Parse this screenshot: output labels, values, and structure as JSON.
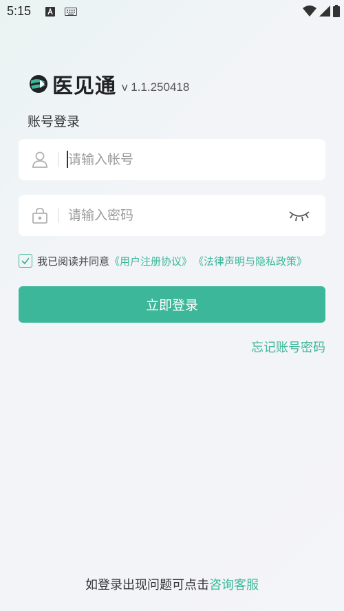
{
  "status_bar": {
    "time": "5:15",
    "icons": [
      "a-notification-icon",
      "keyboard-icon",
      "wifi-icon",
      "signal-icon",
      "battery-icon"
    ]
  },
  "app": {
    "logo_text": "医见通",
    "version": "v 1.1.250418"
  },
  "login": {
    "title": "账号登录",
    "account_placeholder": "请输入帐号",
    "password_placeholder": "请输入密码",
    "agree_prefix": "我已阅读并同意",
    "user_agreement": "《用户注册协议》",
    "privacy_policy": "《法律声明与隐私政策》",
    "agree_checked": true,
    "submit_label": "立即登录",
    "forgot_label": "忘记账号密码"
  },
  "footer": {
    "text": "如登录出现问题可点击",
    "link": "咨询客服"
  },
  "colors": {
    "accent": "#3cb79a",
    "text": "#333333",
    "placeholder": "#9b9b9b"
  }
}
